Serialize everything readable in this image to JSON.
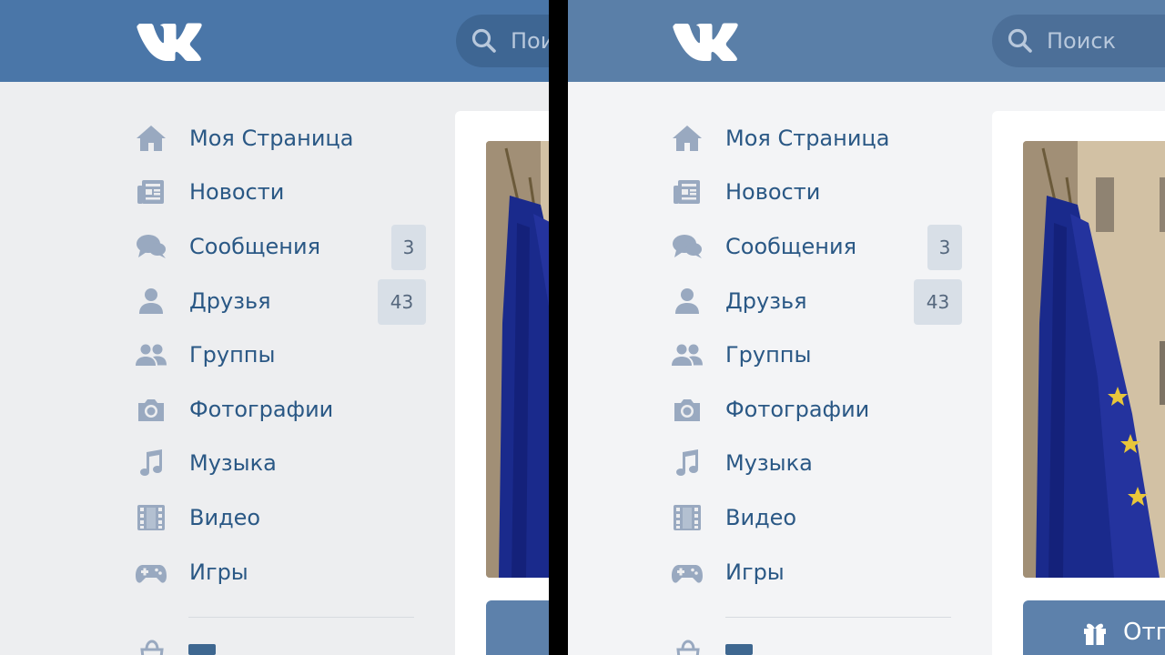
{
  "search": {
    "placeholder": "Поиск",
    "cropped_placeholder": "Пои"
  },
  "menu": {
    "items": [
      {
        "label": "Моя Страница",
        "icon": "home-icon"
      },
      {
        "label": "Новости",
        "icon": "news-icon"
      },
      {
        "label": "Сообщения",
        "icon": "messages-icon",
        "badge": "3"
      },
      {
        "label": "Друзья",
        "icon": "friends-icon",
        "badge": "43"
      },
      {
        "label": "Группы",
        "icon": "groups-icon"
      },
      {
        "label": "Фотографии",
        "icon": "camera-icon"
      },
      {
        "label": "Музыка",
        "icon": "music-icon"
      },
      {
        "label": "Видео",
        "icon": "video-icon"
      },
      {
        "label": "Игры",
        "icon": "games-icon"
      }
    ]
  },
  "gift_button": {
    "label": "Отп",
    "cropped_label": ""
  },
  "colors": {
    "header_left": "#4a76a8",
    "header_right": "#5a7fa8",
    "link": "#2a5885",
    "icon": "#99a9c0",
    "badge_bg": "#d8dfe7"
  }
}
